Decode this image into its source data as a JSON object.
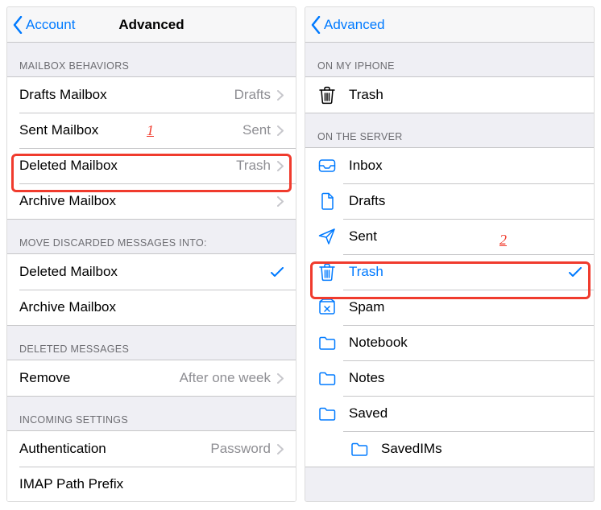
{
  "left": {
    "back_label": "Account",
    "title": "Advanced",
    "sections": {
      "behaviors_header": "Mailbox Behaviors",
      "behaviors": [
        {
          "label": "Drafts Mailbox",
          "value": "Drafts"
        },
        {
          "label": "Sent Mailbox",
          "value": "Sent"
        },
        {
          "label": "Deleted Mailbox",
          "value": "Trash"
        },
        {
          "label": "Archive Mailbox",
          "value": ""
        }
      ],
      "discarded_header": "Move Discarded Messages Into:",
      "discarded": [
        {
          "label": "Deleted Mailbox",
          "checked": true
        },
        {
          "label": "Archive Mailbox",
          "checked": false
        }
      ],
      "deleted_header": "Deleted Messages",
      "deleted": [
        {
          "label": "Remove",
          "value": "After one week"
        }
      ],
      "incoming_header": "Incoming Settings",
      "incoming": [
        {
          "label": "Authentication",
          "value": "Password"
        },
        {
          "label": "IMAP Path Prefix",
          "value": ""
        }
      ]
    }
  },
  "right": {
    "back_label": "Advanced",
    "title": "",
    "sections": {
      "on_phone_header": "On My iPhone",
      "on_phone": [
        {
          "icon": "trash-black",
          "label": "Trash",
          "selected": false
        }
      ],
      "on_server_header": "On the Server",
      "on_server": [
        {
          "icon": "inbox",
          "label": "Inbox",
          "selected": false
        },
        {
          "icon": "drafts",
          "label": "Drafts",
          "selected": false
        },
        {
          "icon": "sent",
          "label": "Sent",
          "selected": false
        },
        {
          "icon": "trash",
          "label": "Trash",
          "selected": true
        },
        {
          "icon": "spam",
          "label": "Spam",
          "selected": false
        },
        {
          "icon": "folder",
          "label": "Notebook",
          "selected": false
        },
        {
          "icon": "folder",
          "label": "Notes",
          "selected": false
        },
        {
          "icon": "folder",
          "label": "Saved",
          "selected": false
        }
      ],
      "nested": [
        {
          "icon": "folder",
          "label": "SavedIMs"
        }
      ]
    }
  },
  "callouts": {
    "one": "1",
    "two": "2"
  },
  "colors": {
    "accent": "#007aff",
    "highlight": "#f03b2d",
    "secondary_text": "#8e8e93",
    "group_bg": "#efeff4"
  }
}
